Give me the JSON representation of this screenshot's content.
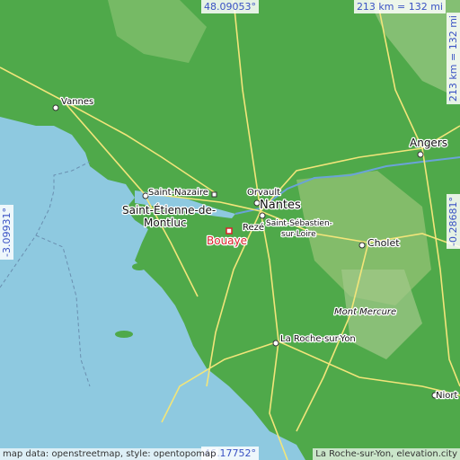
{
  "map": {
    "coordinates": {
      "top": "48.09053°",
      "bottom": "46.17752°",
      "left": "-3.09931°",
      "right": "-0.28681°"
    },
    "scale": {
      "horizontal": "213 km = 132 mi",
      "vertical": "213 km = 132 mi"
    },
    "attribution": {
      "left": "map data: openstreetmap, style: opentopomap",
      "right": "La Roche-sur-Yon, elevation.city"
    },
    "places": {
      "vannes": "Vannes",
      "angers": "Angers",
      "saint_nazaire": "Saint-Nazaire",
      "saint_etienne_1": "Saint-Étienne-de-",
      "saint_etienne_2": "Montluc",
      "orvault": "Orvault",
      "nantes": "Nantes",
      "reze": "Rezé",
      "bouaye": "Bouaye",
      "saint_sebastien_1": "Saint-Sébastien-",
      "saint_sebastien_2": "sur-Loire",
      "cholet": "Cholet",
      "mont_mercure": "Mont Mercure",
      "la_roche_sur_yon": "La Roche-sur-Yon",
      "niort": "Niort"
    },
    "colors": {
      "sea": "#8ec9e0",
      "land": "#4fa94a",
      "highlight": "#d9232b"
    }
  }
}
